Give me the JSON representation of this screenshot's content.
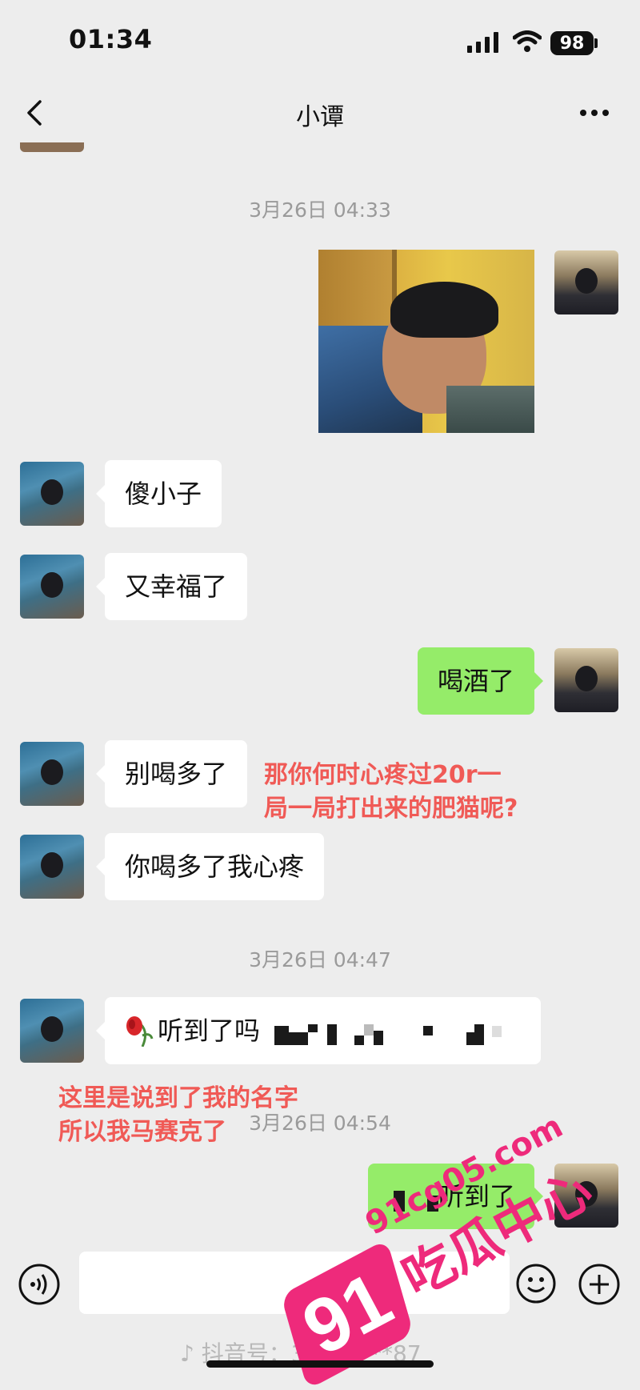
{
  "status_bar": {
    "time": "01:34",
    "battery": "98"
  },
  "nav": {
    "title": "小谭"
  },
  "timestamps": [
    "3月26日 04:33",
    "3月26日 04:47",
    "3月26日 04:54"
  ],
  "messages": [
    {
      "text": "傻小子"
    },
    {
      "text": "又幸福了"
    },
    {
      "text": "喝酒了"
    },
    {
      "text": "别喝多了"
    },
    {
      "text": "你喝多了我心疼"
    },
    {
      "text": "听到了吗"
    },
    {
      "text": "听到了"
    }
  ],
  "annotations": {
    "top_line1": "那你何时心疼过20r一",
    "top_line2": "局一局打出来的肥猫呢?",
    "bottom_line1": "这里是说到了我的名字",
    "bottom_line2": "所以我马赛克了"
  },
  "watermarks": {
    "douyin": "抖音号：3180****87",
    "site_url": "91cg05.com",
    "brand_number": "91",
    "brand_text": "吃瓜中心"
  },
  "colors": {
    "accent_green": "#95ec69",
    "annotation_red": "#f05a56",
    "brand_pink": "#ee2a7b"
  },
  "icons": [
    "back-chevron-icon",
    "more-dots-icon",
    "signal-icon",
    "wifi-icon",
    "battery-icon",
    "voice-icon",
    "emoji-icon",
    "plus-icon",
    "rose-emoji-icon",
    "douyin-logo-icon"
  ]
}
